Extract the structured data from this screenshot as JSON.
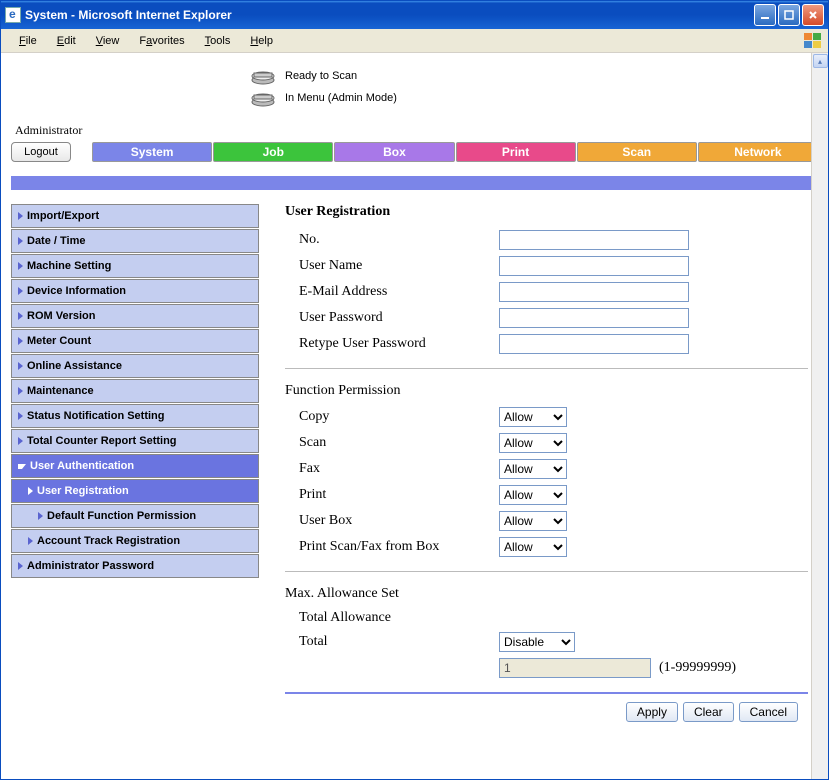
{
  "window": {
    "title": "System - Microsoft Internet Explorer"
  },
  "menubar": {
    "file": "File",
    "edit": "Edit",
    "view": "View",
    "favorites": "Favorites",
    "tools": "Tools",
    "help": "Help"
  },
  "status": {
    "line1": "Ready to Scan",
    "line2": "In Menu (Admin Mode)"
  },
  "admin_label": "Administrator",
  "logout": "Logout",
  "tabs": {
    "system": "System",
    "job": "Job",
    "box": "Box",
    "print": "Print",
    "scan": "Scan",
    "network": "Network"
  },
  "sidebar": [
    {
      "label": "Import/Export"
    },
    {
      "label": "Date / Time"
    },
    {
      "label": "Machine Setting"
    },
    {
      "label": "Device Information"
    },
    {
      "label": "ROM Version"
    },
    {
      "label": "Meter Count"
    },
    {
      "label": "Online Assistance"
    },
    {
      "label": "Maintenance"
    },
    {
      "label": "Status Notification Setting"
    },
    {
      "label": "Total Counter Report Setting"
    },
    {
      "label": "User Authentication"
    },
    {
      "label": "User Registration"
    },
    {
      "label": "Default Function Permission"
    },
    {
      "label": "Account Track Registration"
    },
    {
      "label": "Administrator Password"
    }
  ],
  "panel": {
    "title": "User Registration",
    "fields": {
      "no": "No.",
      "user_name": "User Name",
      "email": "E-Mail Address",
      "password": "User Password",
      "password2": "Retype User Password"
    },
    "values": {
      "no": "",
      "user_name": "",
      "email": "",
      "password": "",
      "password2": ""
    },
    "function_permission": {
      "title": "Function Permission",
      "rows": {
        "copy": "Copy",
        "scan": "Scan",
        "fax": "Fax",
        "print": "Print",
        "user_box": "User Box",
        "print_scan_fax_from_box": "Print Scan/Fax from Box"
      },
      "options": [
        "Allow"
      ],
      "values": {
        "copy": "Allow",
        "scan": "Allow",
        "fax": "Allow",
        "print": "Allow",
        "user_box": "Allow",
        "print_scan_fax_from_box": "Allow"
      }
    },
    "max_allowance": {
      "title": "Max. Allowance Set",
      "subtitle": "Total Allowance",
      "total_label": "Total",
      "total_select": "Disable",
      "total_options": [
        "Disable"
      ],
      "total_value": "1",
      "total_range": "(1-99999999)"
    },
    "buttons": {
      "apply": "Apply",
      "clear": "Clear",
      "cancel": "Cancel"
    }
  }
}
